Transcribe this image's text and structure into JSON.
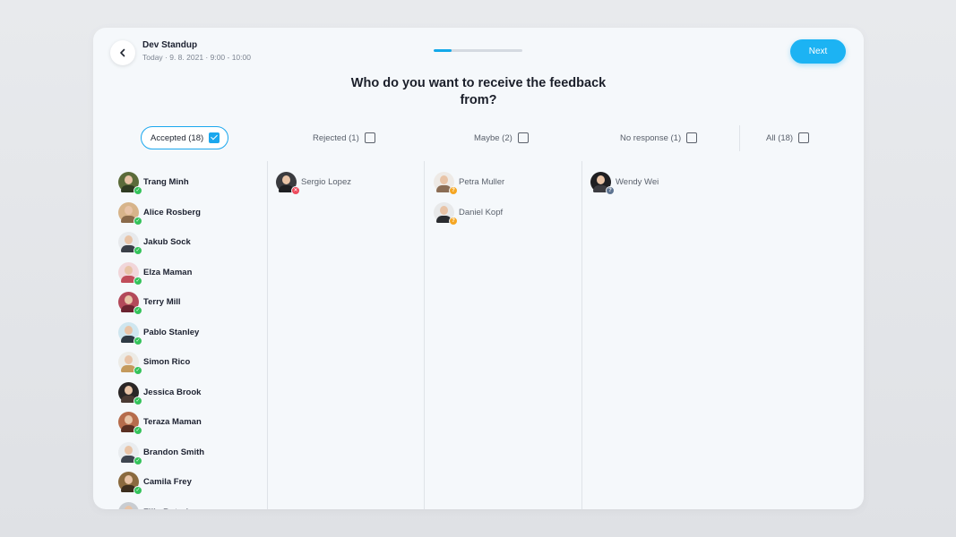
{
  "header": {
    "title": "Dev Standup",
    "subtitle": "Today · 9. 8. 2021 · 9:00 - 10:00",
    "progress": 0.2,
    "next_label": "Next"
  },
  "question": "Who do you want to receive the feedback from?",
  "filters": {
    "accepted": "Accepted (18)",
    "rejected": "Rejected (1)",
    "maybe": "Maybe (2)",
    "no_response": "No response (1)",
    "all": "All (18)"
  },
  "columns": {
    "accepted": [
      {
        "name": "Trang Minh",
        "bg": "#5b6b3a",
        "body": "#2f3b22"
      },
      {
        "name": "Alice Rosberg",
        "bg": "#d7b48a",
        "body": "#8a6a4a"
      },
      {
        "name": "Jakub Sock",
        "bg": "#e7e9ec",
        "body": "#3a3f48"
      },
      {
        "name": "Elza Maman",
        "bg": "#f1d6da",
        "body": "#c04d5a"
      },
      {
        "name": "Terry Mill",
        "bg": "#b3495a",
        "body": "#6b2330"
      },
      {
        "name": "Pablo Stanley",
        "bg": "#cfe6ef",
        "body": "#2e3a44"
      },
      {
        "name": "Simon Rico",
        "bg": "#ecebe6",
        "body": "#c49a5c"
      },
      {
        "name": "Jessica Brook",
        "bg": "#2a2626",
        "body": "#4a3a33"
      },
      {
        "name": "Teraza Maman",
        "bg": "#b66c4c",
        "body": "#5a2f22"
      },
      {
        "name": "Brandon Smith",
        "bg": "#e9ecef",
        "body": "#3e4550"
      },
      {
        "name": "Camila Frey",
        "bg": "#8a6a3f",
        "body": "#3c2e1e"
      },
      {
        "name": "Filip Butorin",
        "bg": "#c9cdd2",
        "body": "#4a5058"
      }
    ],
    "rejected": [
      {
        "name": "Sergio Lopez",
        "bg": "#3a3b3f",
        "body": "#1e1f22"
      }
    ],
    "maybe": [
      {
        "name": "Petra Muller",
        "bg": "#eeeae6",
        "body": "#8b6d55"
      },
      {
        "name": "Daniel Kopf",
        "bg": "#e8e9ea",
        "body": "#2a2c30"
      }
    ],
    "no_response": [
      {
        "name": "Wendy Wei",
        "bg": "#1f1f22",
        "body": "#3b3b40"
      }
    ]
  },
  "status_icons": {
    "accepted": "✓",
    "rejected": "✕",
    "maybe": "?",
    "no_response": "?"
  },
  "colors": {
    "accent": "#1cb3f3",
    "accepted": "#33c25a",
    "rejected": "#ee4a5c",
    "maybe": "#f5a623",
    "no_response": "#5d7390"
  }
}
